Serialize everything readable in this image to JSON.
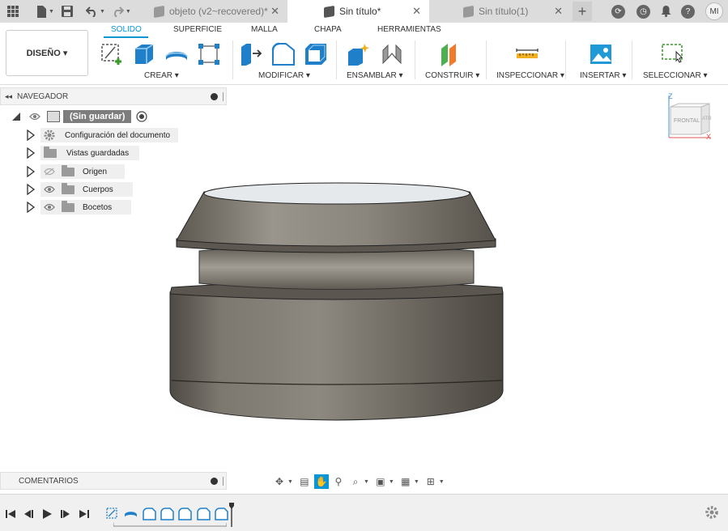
{
  "tabs": [
    {
      "label": "objeto (v2~recovered)*",
      "active": false
    },
    {
      "label": "Sin título*",
      "active": true
    },
    {
      "label": "Sin título(1)",
      "active": false
    }
  ],
  "user_initials": "MI",
  "ribbon": {
    "workspace": "DISEÑO ▾",
    "tabs": [
      "SOLIDO",
      "SUPERFICIE",
      "MALLA",
      "CHAPA",
      "HERRAMIENTAS"
    ],
    "groups": [
      "CREAR ▾",
      "MODIFICAR ▾",
      "ENSAMBLAR ▾",
      "CONSTRUIR ▾",
      "INSPECCIONAR ▾",
      "INSERTAR ▾",
      "SELECCIONAR ▾"
    ]
  },
  "navigator": {
    "title": "NAVEGADOR",
    "root": "(Sin guardar)",
    "items": [
      {
        "label": "Configuración del documento",
        "icon": "gear-icon"
      },
      {
        "label": "Vistas guardadas",
        "icon": "folder-icon"
      },
      {
        "label": "Origen",
        "icon": "folder-icon",
        "hidden": true
      },
      {
        "label": "Cuerpos",
        "icon": "folder-icon"
      },
      {
        "label": "Bocetos",
        "icon": "folder-icon"
      }
    ]
  },
  "viewcube": {
    "face": "FRONTAL",
    "side": "ATR",
    "axis_z": "Z",
    "axis_x": "X"
  },
  "comments_title": "COMENTARIOS",
  "colors": {
    "accent": "#0696d7",
    "body": "#6f6a62"
  }
}
